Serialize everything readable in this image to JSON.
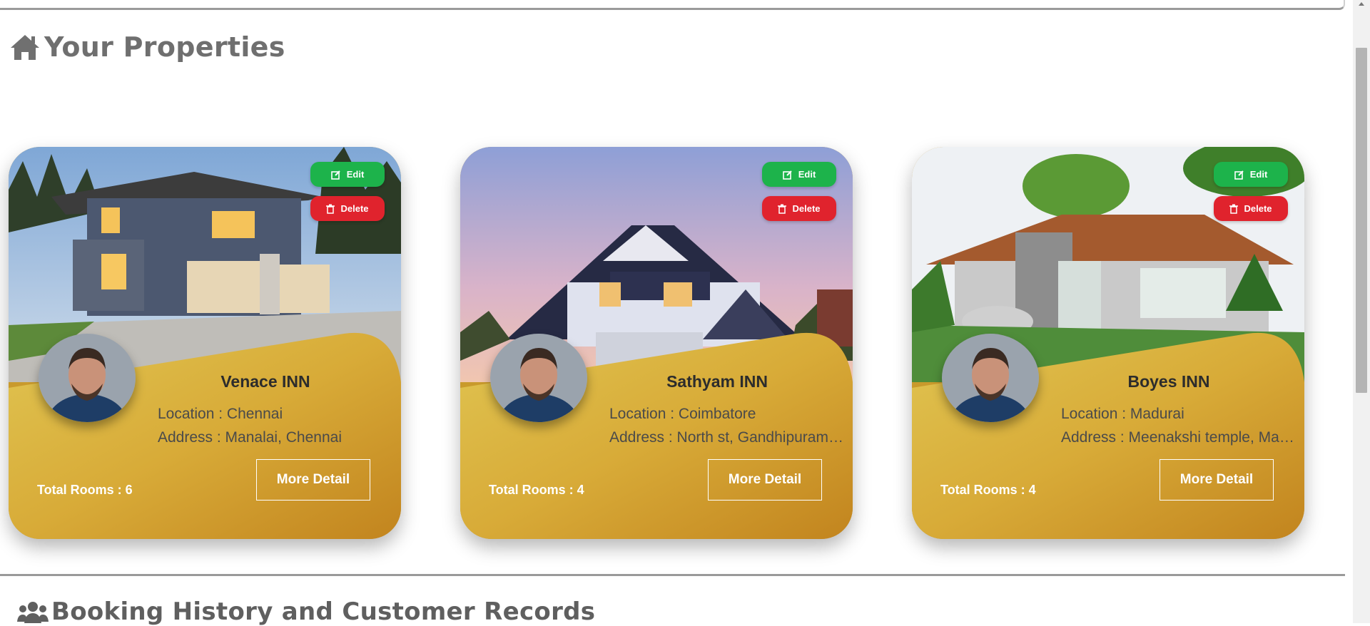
{
  "page": {
    "title": "Your Properties",
    "section2_title": "Booking History and Customer Records"
  },
  "buttons": {
    "edit": "Edit",
    "delete": "Delete",
    "more": "More Detail"
  },
  "properties": [
    {
      "name": "Venace INN",
      "location": "Location : Chennai",
      "address": "Address : Manalai, Chennai",
      "rooms": "Total Rooms : 6"
    },
    {
      "name": "Sathyam INN",
      "location": "Location : Coimbatore",
      "address": "Address : North st, Gandhipuram, Coimbatore",
      "rooms": "Total Rooms : 4"
    },
    {
      "name": "Boyes INN",
      "location": "Location : Madurai",
      "address": "Address : Meenakshi temple, Madurai",
      "rooms": "Total Rooms : 4"
    }
  ],
  "colors": {
    "gold": "#c99a2c",
    "edit": "#1db34b",
    "delete": "#e0232d"
  },
  "icons": [
    "home-icon",
    "edit-icon",
    "trash-icon",
    "users-icon"
  ]
}
